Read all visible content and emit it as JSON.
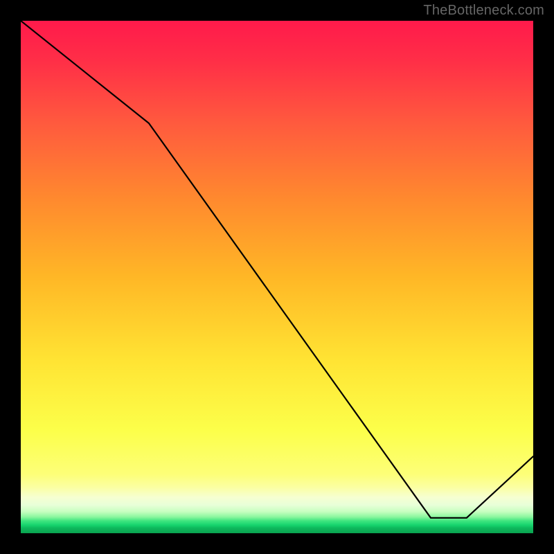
{
  "attribution": "TheBottleneck.com",
  "chart_data": {
    "type": "line",
    "title": "",
    "xlabel": "",
    "ylabel": "",
    "xlim": [
      0,
      100
    ],
    "ylim": [
      0,
      100
    ],
    "x": [
      0,
      25,
      80,
      87,
      100
    ],
    "values": [
      100,
      80,
      3,
      3,
      15
    ],
    "annotations": [
      {
        "text": "",
        "x": 80,
        "y": 3
      }
    ]
  },
  "colors": {
    "curve": "#000000",
    "annotation": "#d01b1b"
  }
}
